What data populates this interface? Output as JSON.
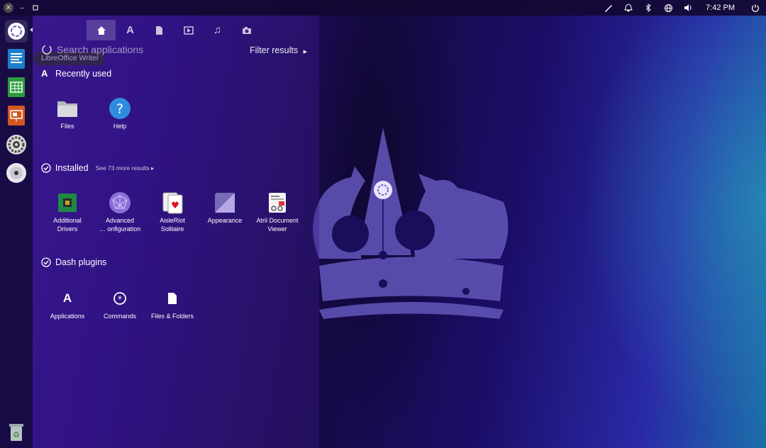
{
  "top_panel": {
    "clock": "7:42 PM",
    "indicators": [
      "pen-icon",
      "bell-icon",
      "bluetooth-icon",
      "network-globe-icon",
      "volume-icon",
      "power-icon"
    ]
  },
  "launcher": {
    "tooltip": "LibreOffice Writer",
    "items": [
      "ubuntu-dash-icon",
      "libreoffice-writer-icon",
      "libreoffice-calc-icon",
      "libreoffice-impress-icon",
      "system-settings-icon",
      "disc-icon",
      "trash-icon"
    ]
  },
  "dash": {
    "lenses": [
      "home-lens-icon",
      "applications-lens-icon",
      "files-lens-icon",
      "video-lens-icon",
      "music-lens-icon",
      "photo-lens-icon"
    ],
    "search": {
      "placeholder": "Search applications"
    },
    "filter_label": "Filter results",
    "sections": {
      "recent": {
        "title": "Recently used",
        "items": [
          "Files",
          "Help"
        ]
      },
      "installed": {
        "title": "Installed",
        "see_more": "See 73 more results",
        "items": [
          "Additional\nDrivers",
          "Advanced\n… onfiguration",
          "AisleRiot\nSolitaire",
          "Appearance",
          "Atril Document\nViewer"
        ]
      },
      "plugins": {
        "title": "Dash plugins",
        "items": [
          "Applications",
          "Commands",
          "Files & Folders"
        ]
      }
    }
  },
  "colors": {
    "accent": "#7a5acc",
    "panel": "#120832",
    "crown": "#5b4fb0"
  }
}
